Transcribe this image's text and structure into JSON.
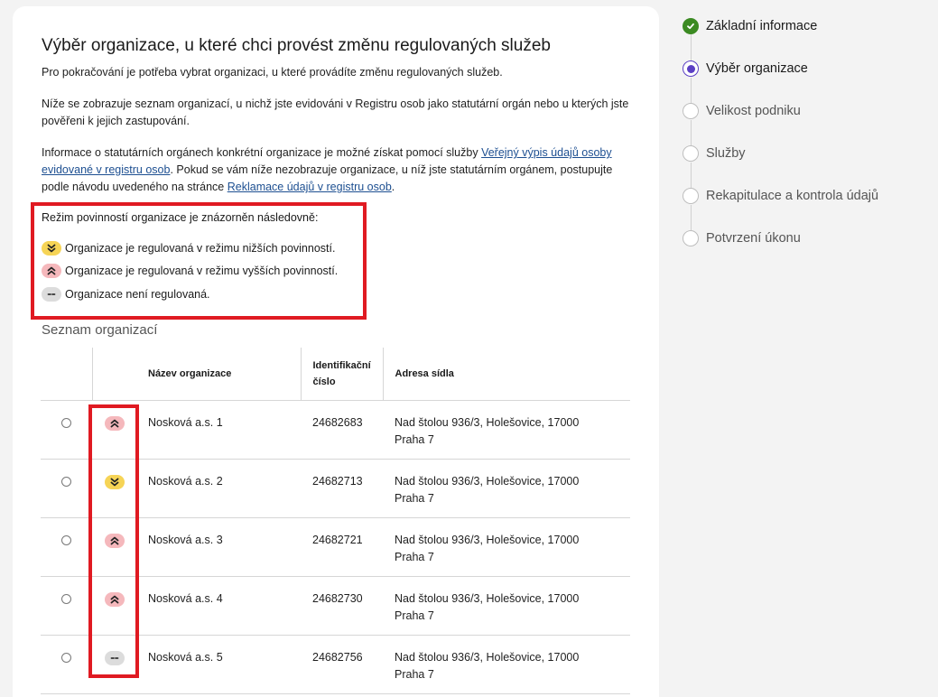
{
  "title": "Výběr organizace, u které chci provést změnu regulovaných služeb",
  "intro": "Pro pokračování je potřeba vybrat organizaci, u které provádíte změnu regulovaných služeb.",
  "para2": "Níže se zobrazuje seznam organizací, u nichž jste evidováni v Registru osob jako statutární orgán nebo u kterých jste pověřeni k jejich zastupování.",
  "para3": {
    "text_before": "Informace o statutárních orgánech konkrétní organizace je možné získat pomocí služby ",
    "link1": "Veřejný výpis údajů osoby evidované v registru osob",
    "text_middle": ". Pokud se vám níže nezobrazuje organizace, u níž jste statutárním orgánem, postupujte podle návodu uvedeného na stránce ",
    "link2": "Reklamace údajů v registru osob",
    "text_after": "."
  },
  "legend": {
    "heading": "Režim povinností organizace je znázorněn následovně:",
    "items": [
      {
        "type": "low",
        "icon": "chevrons-down-icon",
        "text": "Organizace je regulovaná v režimu nižších povinností."
      },
      {
        "type": "high",
        "icon": "chevrons-up-icon",
        "text": "Organizace je regulovaná v režimu vyšších povinností."
      },
      {
        "type": "none",
        "icon": "dashes-icon",
        "text": "Organizace není regulovaná."
      }
    ]
  },
  "list_heading": "Seznam organizací",
  "table": {
    "headers": {
      "name": "Název organizace",
      "id_line1": "Identifikační",
      "id_line2": "číslo",
      "address": "Adresa sídla"
    },
    "rows": [
      {
        "regime": "high",
        "name": "Nosková a.s. 1",
        "id": "24682683",
        "address1": "Nad štolou 936/3, Holešovice, 17000",
        "address2": "Praha 7"
      },
      {
        "regime": "low",
        "name": "Nosková a.s. 2",
        "id": "24682713",
        "address1": "Nad štolou 936/3, Holešovice, 17000",
        "address2": "Praha 7"
      },
      {
        "regime": "high",
        "name": "Nosková a.s. 3",
        "id": "24682721",
        "address1": "Nad štolou 936/3, Holešovice, 17000",
        "address2": "Praha 7"
      },
      {
        "regime": "high",
        "name": "Nosková a.s. 4",
        "id": "24682730",
        "address1": "Nad štolou 936/3, Holešovice, 17000",
        "address2": "Praha 7"
      },
      {
        "regime": "none",
        "name": "Nosková a.s. 5",
        "id": "24682756",
        "address1": "Nad štolou 936/3, Holešovice, 17000",
        "address2": "Praha 7"
      }
    ]
  },
  "stepper": [
    {
      "label": "Základní informace",
      "state": "done"
    },
    {
      "label": "Výběr organizace",
      "state": "current"
    },
    {
      "label": "Velikost podniku",
      "state": "todo"
    },
    {
      "label": "Služby",
      "state": "todo"
    },
    {
      "label": "Rekapitulace a kontrola údajů",
      "state": "todo"
    },
    {
      "label": "Potvrzení úkonu",
      "state": "todo"
    }
  ],
  "colors": {
    "accent": "#5b3fc4",
    "done": "#3b8a22",
    "highlight": "#e01a22",
    "badge_low": "#f6d456",
    "badge_high": "#f5b8bc",
    "badge_none": "#dcdcdc",
    "link": "#1d4f91"
  }
}
